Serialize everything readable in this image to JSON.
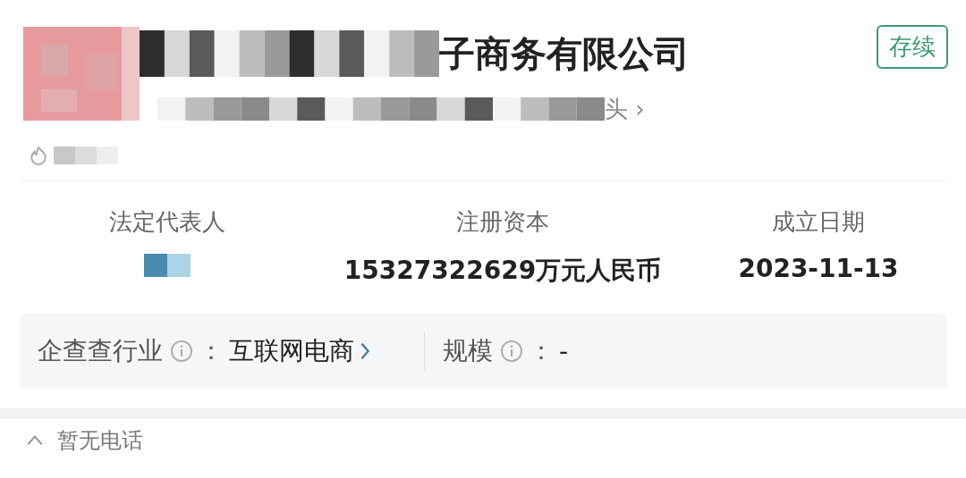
{
  "company": {
    "name": "子商务有限公司",
    "status": "存续",
    "subtitle": "头",
    "subtitle_arrow": "›"
  },
  "stats": [
    {
      "label": "法定代表人",
      "kind": "masked"
    },
    {
      "label": "注册资本",
      "kind": "text",
      "value": "15327322629万元人民币"
    },
    {
      "label": "成立日期",
      "kind": "text",
      "value": "2023-11-13"
    }
  ],
  "info": [
    {
      "label": "企查查行业",
      "value": "互联网电商",
      "link": true
    },
    {
      "label": "规模",
      "value": "-",
      "link": false
    }
  ],
  "separator": "：",
  "contact": {
    "text": "暂无电话"
  }
}
